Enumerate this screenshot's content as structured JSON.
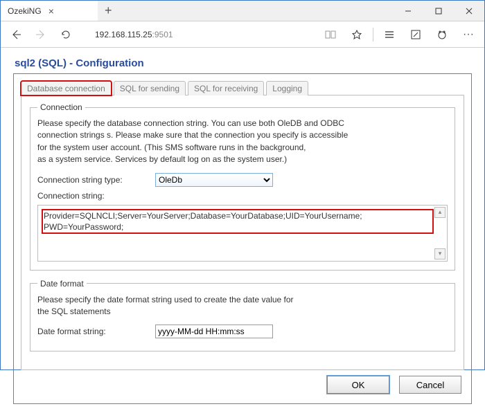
{
  "browser": {
    "tab_title": "OzekiNG",
    "address_host": "192.168.115.25",
    "address_port": ":9501"
  },
  "page": {
    "title": "sql2 (SQL) - Configuration"
  },
  "tabs": {
    "db": "Database connection",
    "send": "SQL for sending",
    "recv": "SQL for receiving",
    "log": "Logging"
  },
  "connection": {
    "legend": "Connection",
    "desc": "Please specify the database connection string. You can use both OleDB and ODBC\nconnection strings s. Please make sure that the connection you specify is accessible\nfor the system user account. (This SMS software runs in the background,\nas a system service. Services by default log on as the system user.)",
    "type_label": "Connection string type:",
    "type_value": "OleDb",
    "string_label": "Connection string:",
    "string_value": "Provider=SQLNCLI;Server=YourServer;Database=YourDatabase;UID=YourUsername;\nPWD=YourPassword;"
  },
  "dateformat": {
    "legend": "Date format",
    "desc": "Please specify the date format string used to create the date value for\nthe SQL statements",
    "label": "Date format string:",
    "value": "yyyy-MM-dd HH:mm:ss"
  },
  "buttons": {
    "ok": "OK",
    "cancel": "Cancel"
  }
}
